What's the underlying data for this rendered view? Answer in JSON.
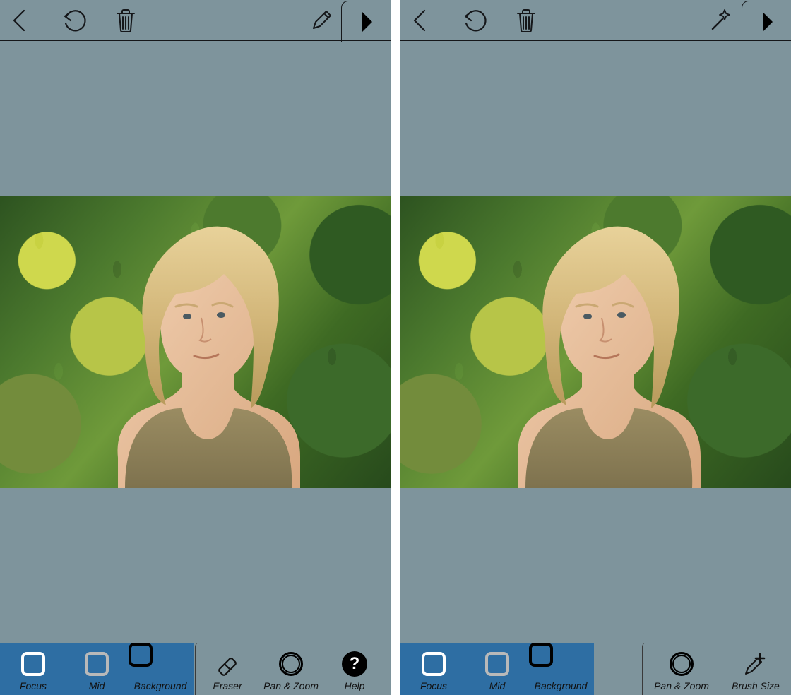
{
  "panes": [
    {
      "top_right_tool": "pencil",
      "toolbar": [
        {
          "id": "focus",
          "label": "Focus",
          "icon": "square-white",
          "group": "primary",
          "selected": true
        },
        {
          "id": "mid",
          "label": "Mid",
          "icon": "square-grey",
          "group": "primary",
          "selected": false
        },
        {
          "id": "background",
          "label": "Background",
          "icon": "square-black",
          "group": "primary",
          "selected": false
        },
        {
          "id": "eraser",
          "label": "Eraser",
          "icon": "eraser",
          "group": "secondary"
        },
        {
          "id": "panzoom",
          "label": "Pan & Zoom",
          "icon": "ring",
          "group": "secondary"
        },
        {
          "id": "help",
          "label": "Help",
          "icon": "help",
          "group": "secondary"
        }
      ]
    },
    {
      "top_right_tool": "wand",
      "toolbar": [
        {
          "id": "focus",
          "label": "Focus",
          "icon": "square-white",
          "group": "primary",
          "selected": true
        },
        {
          "id": "mid",
          "label": "Mid",
          "icon": "square-grey",
          "group": "primary",
          "selected": false
        },
        {
          "id": "background",
          "label": "Background",
          "icon": "square-black",
          "group": "primary",
          "selected": false
        },
        {
          "id": "panzoom",
          "label": "Pan & Zoom",
          "icon": "ring",
          "group": "secondary"
        },
        {
          "id": "brushsize",
          "label": "Brush Size",
          "icon": "brush-plus",
          "group": "secondary"
        }
      ]
    }
  ],
  "icons": {
    "back": "chevron-left",
    "undo": "undo",
    "trash": "trash",
    "next": "chevron-right",
    "pencil": "pencil",
    "wand": "magic-wand",
    "eraser": "eraser",
    "ring": "concentric-circles",
    "help": "question-mark",
    "brush-plus": "pencil-with-plus"
  }
}
